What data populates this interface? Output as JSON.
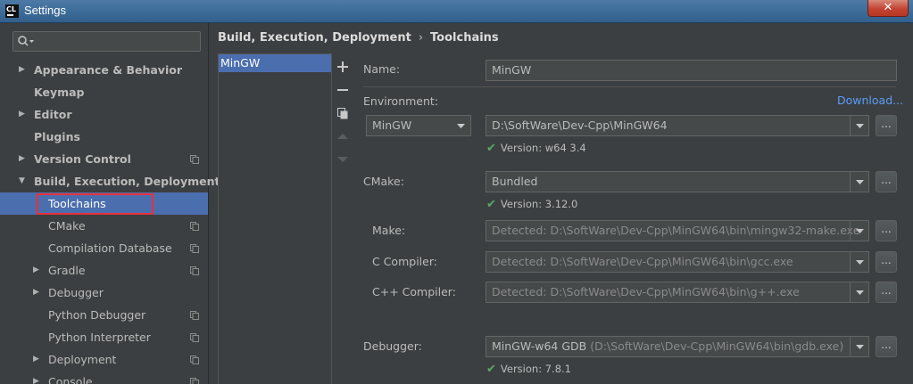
{
  "window": {
    "title": "Settings",
    "app_icon_text": "CL",
    "close_label": "✕"
  },
  "search": {
    "placeholder": ""
  },
  "sidebar": {
    "items": [
      {
        "label": "Appearance & Behavior",
        "bold": true,
        "arrow": "right",
        "indent": 0,
        "copy_icon": false
      },
      {
        "label": "Keymap",
        "bold": true,
        "arrow": "",
        "indent": 0,
        "copy_icon": false
      },
      {
        "label": "Editor",
        "bold": true,
        "arrow": "right",
        "indent": 0,
        "copy_icon": false
      },
      {
        "label": "Plugins",
        "bold": true,
        "arrow": "",
        "indent": 0,
        "copy_icon": false
      },
      {
        "label": "Version Control",
        "bold": true,
        "arrow": "right",
        "indent": 0,
        "copy_icon": true
      },
      {
        "label": "Build, Execution, Deployment",
        "bold": true,
        "arrow": "down",
        "indent": 0,
        "copy_icon": false
      },
      {
        "label": "Toolchains",
        "bold": false,
        "arrow": "",
        "indent": 1,
        "copy_icon": false,
        "selected": true
      },
      {
        "label": "CMake",
        "bold": false,
        "arrow": "",
        "indent": 1,
        "copy_icon": true
      },
      {
        "label": "Compilation Database",
        "bold": false,
        "arrow": "",
        "indent": 1,
        "copy_icon": true
      },
      {
        "label": "Gradle",
        "bold": false,
        "arrow": "right",
        "indent": 1,
        "copy_icon": true
      },
      {
        "label": "Debugger",
        "bold": false,
        "arrow": "right",
        "indent": 1,
        "copy_icon": false
      },
      {
        "label": "Python Debugger",
        "bold": false,
        "arrow": "",
        "indent": 1,
        "copy_icon": true
      },
      {
        "label": "Python Interpreter",
        "bold": false,
        "arrow": "",
        "indent": 1,
        "copy_icon": true
      },
      {
        "label": "Deployment",
        "bold": false,
        "arrow": "right",
        "indent": 1,
        "copy_icon": true
      },
      {
        "label": "Console",
        "bold": false,
        "arrow": "right",
        "indent": 1,
        "copy_icon": true
      }
    ]
  },
  "breadcrumb": {
    "parent": "Build, Execution, Deployment",
    "separator": "›",
    "current": "Toolchains"
  },
  "toolchains": {
    "items": [
      "MinGW"
    ]
  },
  "form": {
    "name_label": "Name:",
    "name_value": "MinGW",
    "environment_label": "Environment:",
    "download_link": "Download...",
    "env_type": "MinGW",
    "env_path": "D:\\SoftWare\\Dev-Cpp\\MinGW64",
    "env_version": "Version: w64 3.4",
    "cmake_label": "CMake:",
    "cmake_value": "Bundled",
    "cmake_version": "Version: 3.12.0",
    "make_label": "Make:",
    "make_value": "Detected: D:\\SoftWare\\Dev-Cpp\\MinGW64\\bin\\mingw32-make.exe",
    "c_compiler_label": "C Compiler:",
    "c_compiler_value": "Detected: D:\\SoftWare\\Dev-Cpp\\MinGW64\\bin\\gcc.exe",
    "cpp_compiler_label": "C++ Compiler:",
    "cpp_compiler_value": "Detected: D:\\SoftWare\\Dev-Cpp\\MinGW64\\bin\\g++.exe",
    "debugger_label": "Debugger:",
    "debugger_value": "MinGW-w64 GDB",
    "debugger_path": "(D:\\SoftWare\\Dev-Cpp\\MinGW64\\bin\\gdb.exe)",
    "debugger_version": "Version: 7.8.1",
    "browse_label": "..."
  },
  "colors": {
    "accent": "#4b6eaf",
    "link": "#589df6",
    "success": "#59a869",
    "highlight": "#e8313a"
  }
}
